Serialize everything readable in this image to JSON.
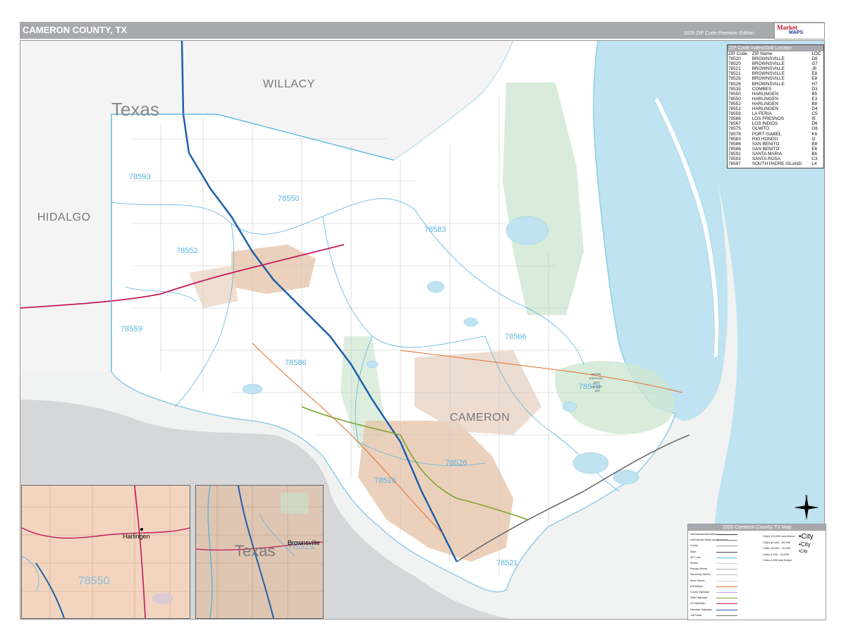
{
  "header": {
    "title": "CAMERON COUNTY, TX",
    "edition": "2026 ZIP Code Premium Edition",
    "logo_line1": "Market",
    "logo_line2": "MAPS"
  },
  "map_labels": {
    "state": "Texas",
    "counties": [
      "WILLACY",
      "HIDALGO",
      "CAMERON"
    ],
    "zips": [
      "78593",
      "78550",
      "78583",
      "78552",
      "78559",
      "78586",
      "78566",
      "78578",
      "78520",
      "78526",
      "78521"
    ],
    "refuge": [
      "LAGUNA",
      "ATASCOSA",
      "NAT'L",
      "WILDLIFE",
      "REF"
    ]
  },
  "index": {
    "title": "ZIP Code Index/Grid Locator",
    "columns": [
      "ZIP Code",
      "ZIP Name",
      "LOC"
    ],
    "rows": [
      [
        "78520",
        "BROWNSVILLE",
        "D8"
      ],
      [
        "78520",
        "BROWNSVILLE",
        "G7"
      ],
      [
        "78521",
        "BROWNSVILLE",
        "J8"
      ],
      [
        "78521",
        "BROWNSVILLE",
        "E8"
      ],
      [
        "78526",
        "BROWNSVILLE",
        "E8"
      ],
      [
        "78526",
        "BROWNSVILLE",
        "H7"
      ],
      [
        "78535",
        "COMBES",
        "D3"
      ],
      [
        "78550",
        "HARLINGEN",
        "B5"
      ],
      [
        "78550",
        "HARLINGEN",
        "E3"
      ],
      [
        "78552",
        "HARLINGEN",
        "B8"
      ],
      [
        "78552",
        "HARLINGEN",
        "D4"
      ],
      [
        "78559",
        "LA FERIA",
        "C5"
      ],
      [
        "78566",
        "LOS FRESNOS",
        "I5"
      ],
      [
        "78567",
        "LOS INDIOS",
        "D6"
      ],
      [
        "78575",
        "OLMITO",
        "G6"
      ],
      [
        "78578",
        "PORT ISABEL",
        "K6"
      ],
      [
        "78583",
        "RIO HONDO",
        "I2"
      ],
      [
        "78586",
        "SAN BENITO",
        "B8"
      ],
      [
        "78586",
        "SAN BENITO",
        "E6"
      ],
      [
        "78592",
        "SANTA MARIA",
        "B6"
      ],
      [
        "78593",
        "SANTA ROSA",
        "C3"
      ],
      [
        "78597",
        "SOUTH PADRE ISLAND",
        "L4"
      ]
    ]
  },
  "legend": {
    "title": "2026 Cameron County, TX Map",
    "items": [
      "International Boundaries",
      "International States and Provinces",
      "County",
      "State",
      "ZIP Code",
      "Streets",
      "Primary Streets",
      "Secondary Streets",
      "Minor Streets",
      "Exit Ramps",
      "County Highways",
      "State Highways",
      "US Highways",
      "Interstate Highways",
      "Toll Roads"
    ],
    "populations": [
      "Cities 100,000 and Above",
      "Cities 50,000 - 99,999",
      "Cities 25,000 - 49,999",
      "Cities 5,000 - 24,999",
      "Cities 4,999 and Below"
    ],
    "city_marks": [
      "City",
      "City",
      "City"
    ]
  },
  "insets": {
    "left_city": "Harlingen",
    "left_zip": "78550",
    "right_city": "Brownsville",
    "right_state": "Texas",
    "right_zip": "78521"
  },
  "colors": {
    "water": "#bfe3f0",
    "land": "#ffffff",
    "outside": "#f1f2f2",
    "gulf_gray": "#d6d7d9",
    "urban": "#e8c9b0",
    "park": "#cfe7d2",
    "zip_label": "#5ab4e0",
    "title_bar": "#a7a9ac"
  }
}
